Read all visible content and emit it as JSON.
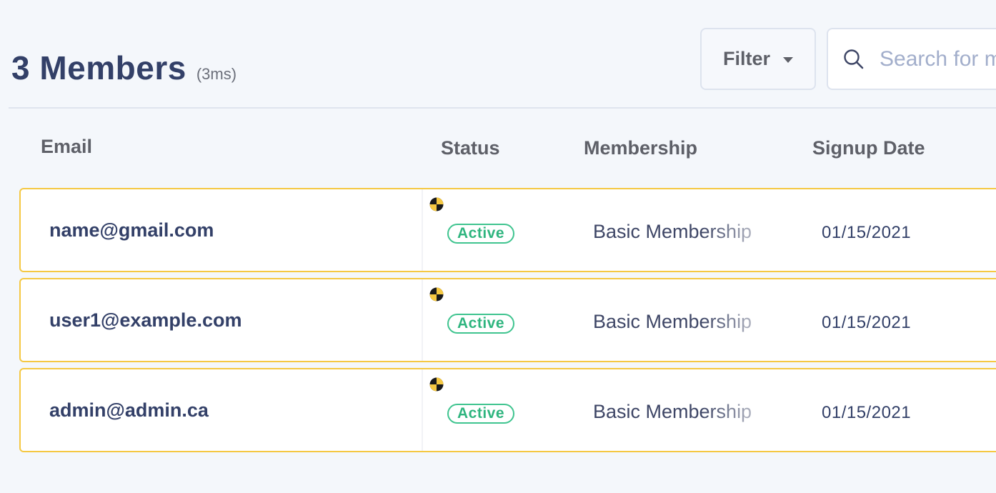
{
  "header": {
    "title": "3 Members",
    "timing": "(3ms)"
  },
  "toolbar": {
    "filter_label": "Filter",
    "search_placeholder": "Search for members"
  },
  "table": {
    "columns": [
      "Email",
      "Status",
      "Membership",
      "Signup Date"
    ],
    "rows": [
      {
        "email": "name@gmail.com",
        "status": "Active",
        "membership": "Basic Membership",
        "signup_date": "01/15/2021"
      },
      {
        "email": "user1@example.com",
        "status": "Active",
        "membership": "Basic Membership",
        "signup_date": "01/15/2021"
      },
      {
        "email": "admin@admin.ca",
        "status": "Active",
        "membership": "Basic Membership",
        "signup_date": "01/15/2021"
      }
    ]
  },
  "colors": {
    "title": "#334068",
    "row_border": "#f5c842",
    "status_active": "#3fc48f",
    "background": "#f4f7fb"
  },
  "icons": {
    "filter": "caret-down-icon",
    "search": "search-icon",
    "row_marker": "debug-marker-icon"
  }
}
